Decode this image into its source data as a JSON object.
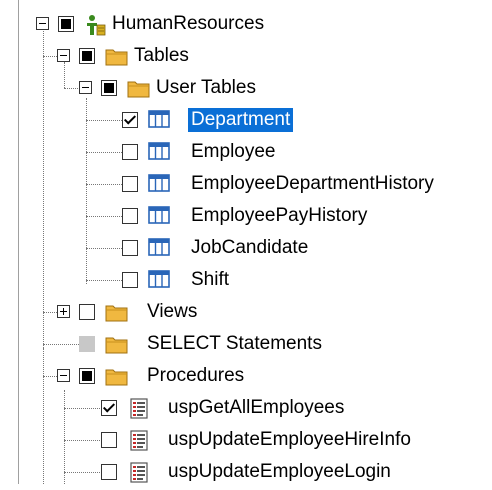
{
  "tree": {
    "root": {
      "label": "HumanResources",
      "icon": "schema-icon"
    },
    "tables": {
      "label": "Tables",
      "icon": "folder-icon"
    },
    "user_tables": {
      "label": "User Tables",
      "icon": "folder-icon"
    },
    "table_items": [
      {
        "label": "Department",
        "checked": true,
        "selected": true,
        "icon": "table-icon"
      },
      {
        "label": "Employee",
        "checked": false,
        "icon": "table-icon"
      },
      {
        "label": "EmployeeDepartmentHistory",
        "checked": false,
        "icon": "table-icon"
      },
      {
        "label": "EmployeePayHistory",
        "checked": false,
        "icon": "table-icon"
      },
      {
        "label": "JobCandidate",
        "checked": false,
        "icon": "table-icon"
      },
      {
        "label": "Shift",
        "checked": false,
        "icon": "table-icon"
      }
    ],
    "views": {
      "label": "Views",
      "icon": "folder-icon"
    },
    "select_statements": {
      "label": "SELECT Statements",
      "icon": "folder-icon"
    },
    "procedures": {
      "label": "Procedures",
      "icon": "folder-icon"
    },
    "procedure_items": [
      {
        "label": "uspGetAllEmployees",
        "checked": true,
        "icon": "procedure-icon"
      },
      {
        "label": "uspUpdateEmployeeHireInfo",
        "checked": false,
        "icon": "procedure-icon"
      },
      {
        "label": "uspUpdateEmployeeLogin",
        "checked": false,
        "icon": "procedure-icon"
      }
    ]
  },
  "colors": {
    "selection": "#0a6fd6",
    "folder": "#f0b840",
    "table_icon": "#2a66b8"
  }
}
